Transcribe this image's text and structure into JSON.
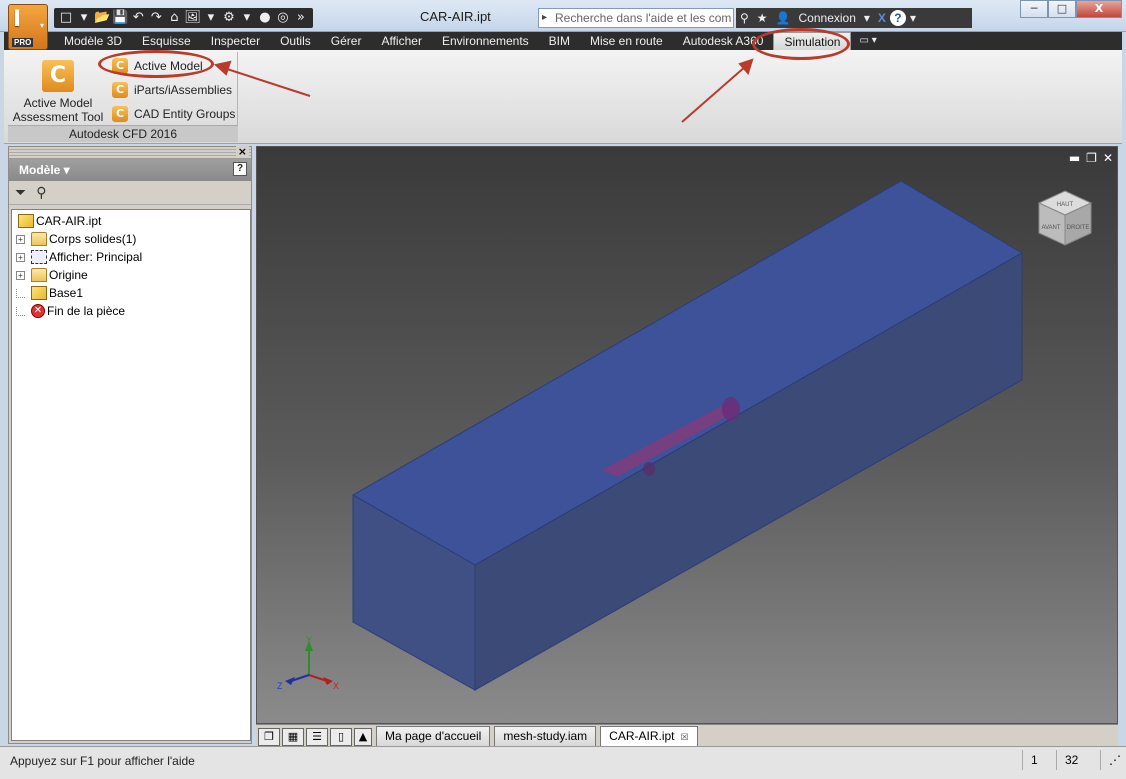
{
  "app": {
    "logo_letter": "I",
    "edition": "PRO"
  },
  "window": {
    "title": "CAR-AIR.ipt",
    "controls": {
      "minimize": "─",
      "restore": "□",
      "close": "X"
    }
  },
  "quick_access": [
    "□",
    "▾",
    "📂",
    "💾",
    "↶",
    "↷",
    "⌂",
    "🖼",
    "▾",
    "⚙",
    "▾",
    "●",
    "◎",
    "»"
  ],
  "help": {
    "search_placeholder": "Recherche dans l'aide et les com",
    "sign_in": "Connexion",
    "help_icon": "?"
  },
  "ribbon_tabs": [
    "Modèle 3D",
    "Esquisse",
    "Inspecter",
    "Outils",
    "Gérer",
    "Afficher",
    "Environnements",
    "BIM",
    "Mise en route",
    "Autodesk A360",
    "Simulation"
  ],
  "active_tab": "Simulation",
  "ribbon": {
    "big_button": {
      "label_line1": "Active Model",
      "label_line2": "Assessment Tool",
      "icon_letter": "C"
    },
    "small_buttons": [
      "Active Model",
      "iParts/iAssemblies",
      "CAD Entity Groups"
    ],
    "panel_title": "Autodesk CFD 2016"
  },
  "browser": {
    "header": "Modèle ▾",
    "help": "?",
    "close": "×",
    "tree": [
      {
        "label": "CAR-AIR.ipt",
        "icon": "part-icon",
        "expander": ""
      },
      {
        "label": "Corps solides(1)",
        "icon": "solid-bodies-icon",
        "expander": "+"
      },
      {
        "label": "Afficher: Principal",
        "icon": "view-rep-icon",
        "expander": "+"
      },
      {
        "label": "Origine",
        "icon": "folder-icon",
        "expander": "+"
      },
      {
        "label": "Base1",
        "icon": "part-icon",
        "expander": ""
      },
      {
        "label": "Fin de la pièce",
        "icon": "end-of-part-icon",
        "expander": ""
      }
    ]
  },
  "viewport": {
    "viewcube_top": "HAUT",
    "viewcube_front": "AVANT",
    "viewcube_right": "DROITE",
    "axis_x": "X",
    "axis_y": "Y",
    "axis_z": "Z"
  },
  "document_tabs": [
    {
      "label": "Ma page d'accueil",
      "active": false
    },
    {
      "label": "mesh-study.iam",
      "active": false
    },
    {
      "label": "CAR-AIR.ipt",
      "active": true,
      "close": "☒"
    }
  ],
  "status": {
    "message": "Appuyez sur F1 pour afficher l'aide",
    "count_a": "1",
    "count_b": "32"
  },
  "colors": {
    "annotation_red": "#b83b2b",
    "model_blue": "#3b4f9a",
    "ribbon_dark": "#2d2d2d"
  }
}
